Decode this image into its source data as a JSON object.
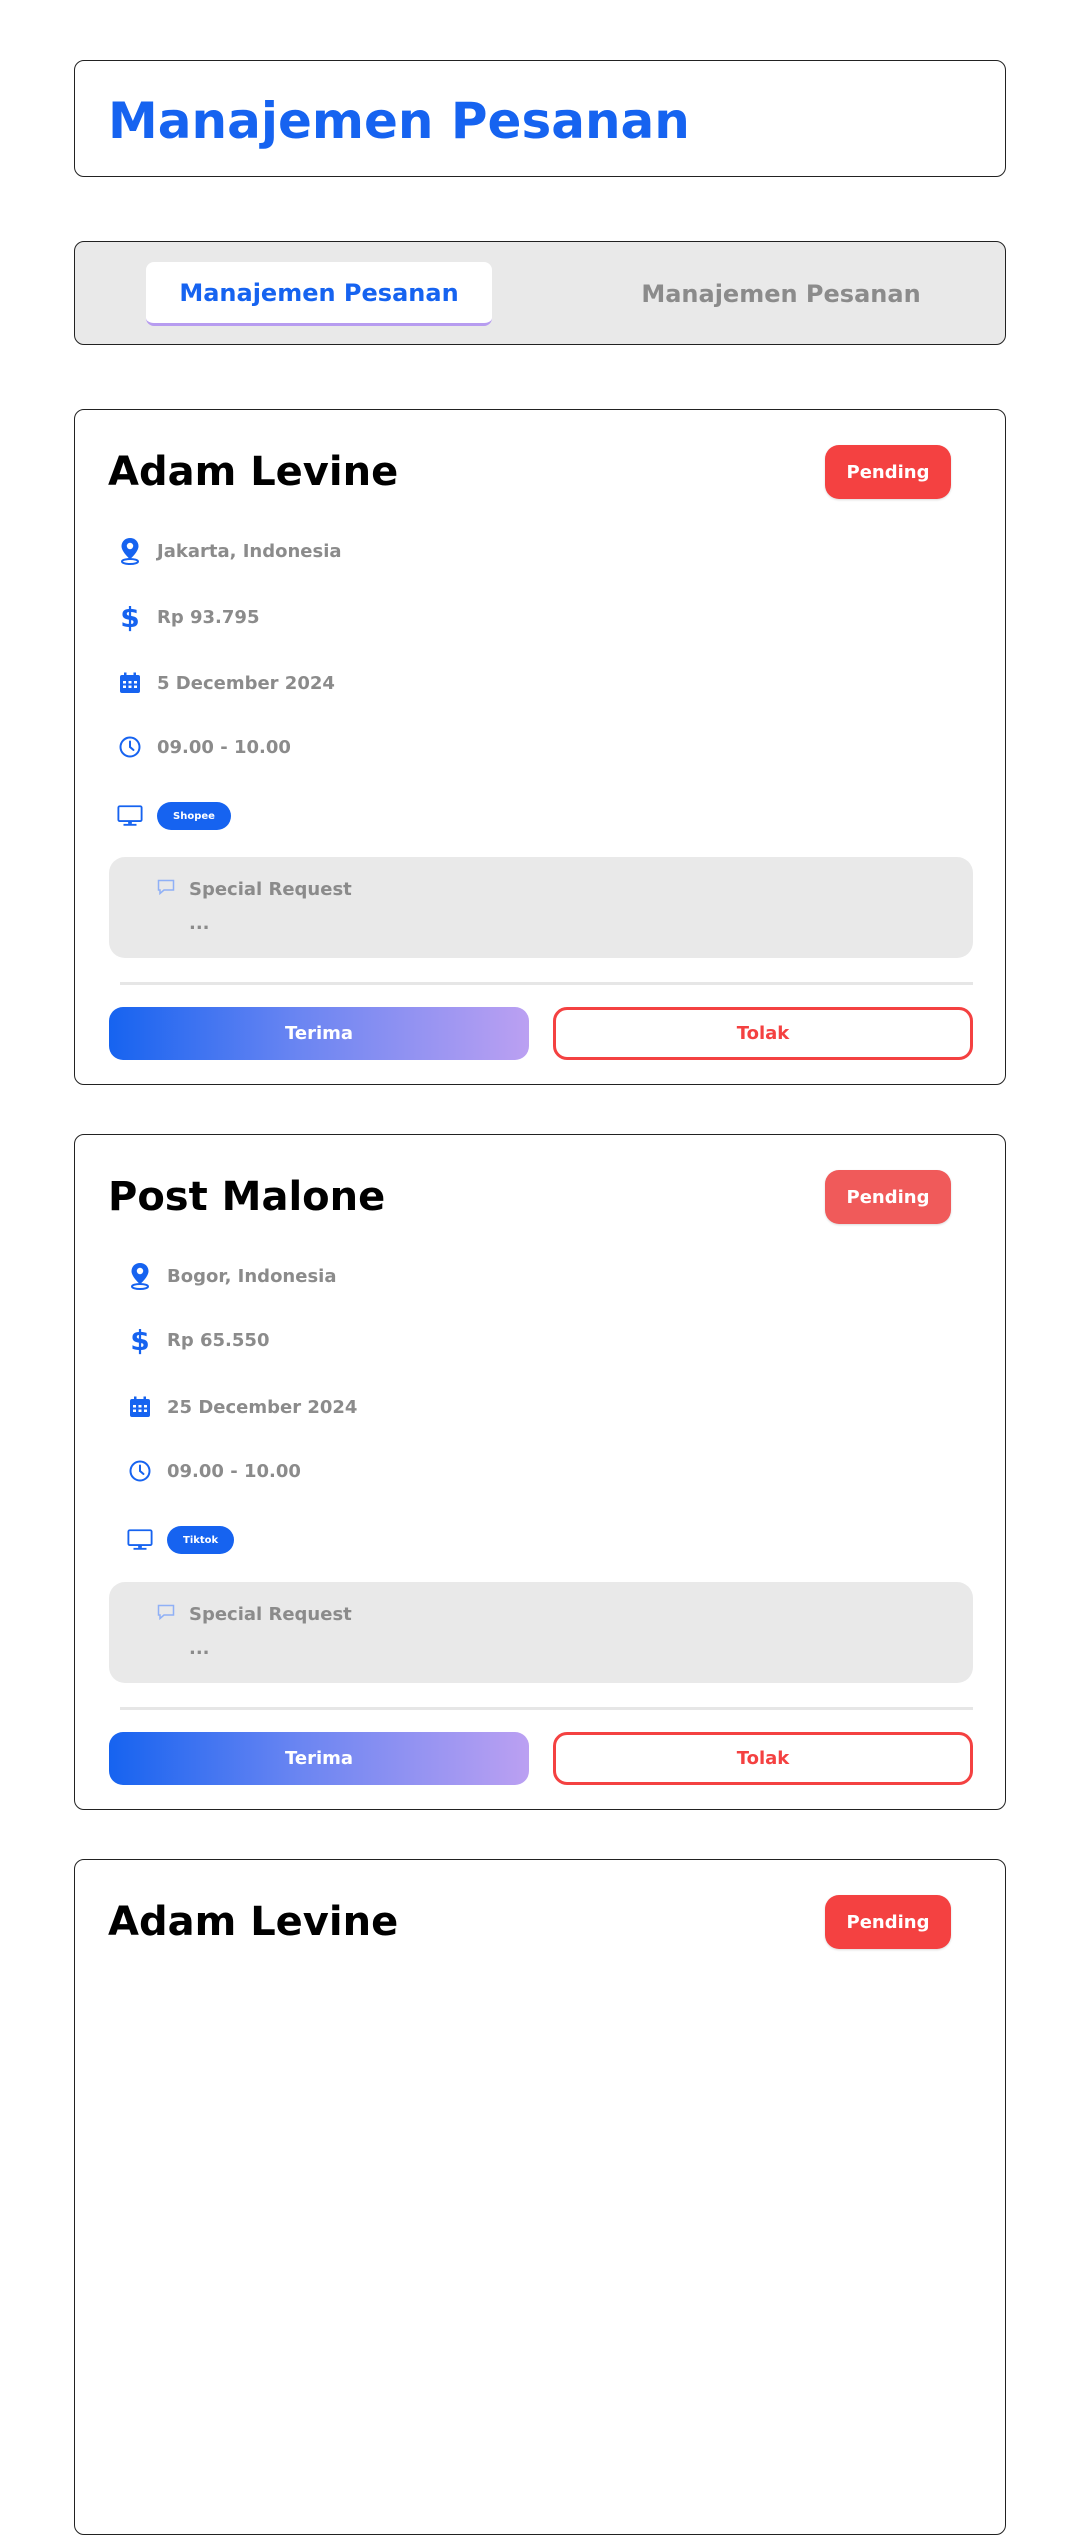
{
  "header": {
    "title": "Manajemen Pesanan"
  },
  "tabs": [
    {
      "label": "Manajemen Pesanan",
      "active": true
    },
    {
      "label": "Manajemen Pesanan",
      "active": false
    }
  ],
  "orders": [
    {
      "name": "Adam Levine",
      "status": "Pending",
      "location": "Jakarta, Indonesia",
      "price": "Rp 93.795",
      "date": "5 December 2024",
      "time": "09.00 - 10.00",
      "platform": "Shopee",
      "request_title": "Special Request",
      "request_body": "...",
      "accept_label": "Terima",
      "reject_label": "Tolak"
    },
    {
      "name": "Post Malone",
      "status": "Pending",
      "location": "Bogor, Indonesia",
      "price": "Rp 65.550",
      "date": "25 December 2024",
      "time": "09.00 - 10.00",
      "platform": "Tiktok",
      "request_title": "Special Request",
      "request_body": "...",
      "accept_label": "Terima",
      "reject_label": "Tolak"
    },
    {
      "name": "Adam Levine",
      "status": "Pending"
    }
  ],
  "colors": {
    "primary": "#1663f0",
    "danger": "#f44141",
    "muted": "#8b8b8b",
    "panel": "#e9e9e9"
  },
  "icons": [
    "map-pin-icon",
    "dollar-icon",
    "calendar-icon",
    "clock-icon",
    "monitor-icon",
    "chat-bubble-icon"
  ]
}
